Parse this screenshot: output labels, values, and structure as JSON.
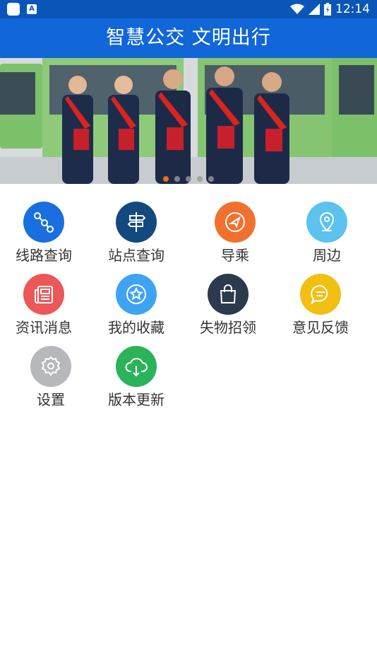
{
  "status_bar": {
    "time": "12:14",
    "icons": [
      "app-icon",
      "keyboard-a-icon",
      "wifi-icon",
      "signal-icon",
      "battery-icon"
    ]
  },
  "header": {
    "title": "智慧公交 文明出行"
  },
  "banner": {
    "slides": 5,
    "active_slide": 1
  },
  "colors": {
    "header_bg": "#1166d8",
    "status_bg": "#0a56b8",
    "indicator_active": "#f36c21"
  },
  "menu": [
    {
      "label": "线路查询",
      "icon": "route-icon",
      "color": "#1a6fe0"
    },
    {
      "label": "站点查询",
      "icon": "signpost-icon",
      "color": "#124a80"
    },
    {
      "label": "导乘",
      "icon": "compass-icon",
      "color": "#f0712e"
    },
    {
      "label": "周边",
      "icon": "location-pin-icon",
      "color": "#5bc3ee"
    },
    {
      "label": "资讯消息",
      "icon": "newspaper-icon",
      "color": "#ec5757"
    },
    {
      "label": "我的收藏",
      "icon": "star-icon",
      "color": "#3ea3f1"
    },
    {
      "label": "失物招领",
      "icon": "shopping-bag-icon",
      "color": "#2b3a4c"
    },
    {
      "label": "意见反馈",
      "icon": "chat-bubble-icon",
      "color": "#f2c013"
    },
    {
      "label": "设置",
      "icon": "gear-icon",
      "color": "#b6b8bb"
    },
    {
      "label": "版本更新",
      "icon": "cloud-download-icon",
      "color": "#2bb35a"
    }
  ]
}
